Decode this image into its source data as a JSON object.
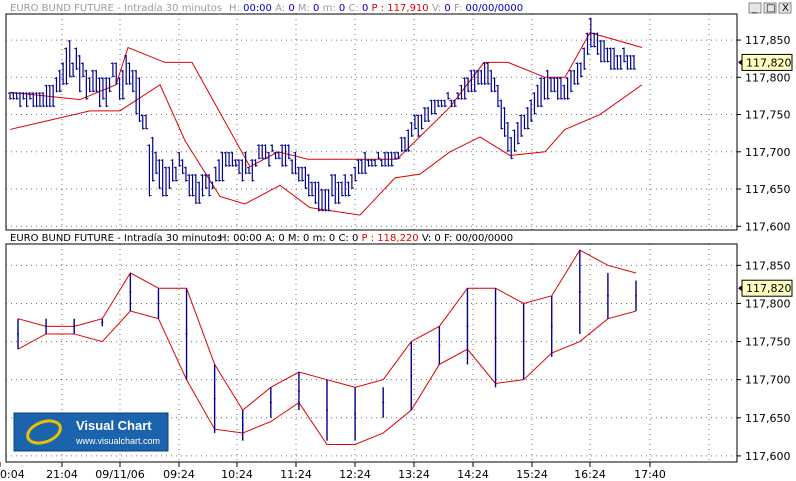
{
  "panels": [
    {
      "title": "EURO BUND FUTURE - Intradía 30 minutos",
      "header_fields": [
        {
          "k": "H:",
          "v": "00:00"
        },
        {
          "k": "A:",
          "v": "0"
        },
        {
          "k": "M:",
          "v": "0"
        },
        {
          "k": "m:",
          "v": "0"
        },
        {
          "k": "C:",
          "v": "0"
        },
        {
          "k": "P :",
          "v": "117,910",
          "accent": true
        },
        {
          "k": "V:",
          "v": "0"
        },
        {
          "k": "F:",
          "v": "00/00/0000"
        }
      ],
      "price_tag": "117,820",
      "controls": [
        "_",
        "□",
        "X"
      ]
    },
    {
      "title": "EURO BUND FUTURE - Intradía 30 minutos",
      "header_fields": [
        {
          "k": "H:",
          "v": "00:00"
        },
        {
          "k": "A:",
          "v": "0"
        },
        {
          "k": "M:",
          "v": "0"
        },
        {
          "k": "m:",
          "v": "0"
        },
        {
          "k": "C:",
          "v": "0"
        },
        {
          "k": "P :",
          "v": "118,220",
          "accent": true
        },
        {
          "k": "V:",
          "v": "0"
        },
        {
          "k": "F:",
          "v": "00/00/0000"
        }
      ],
      "price_tag": "117,820"
    }
  ],
  "x_axis_labels": [
    "0:04",
    "21:04",
    "09/11/06",
    "09:24",
    "10:24",
    "11:24",
    "12:24",
    "13:24",
    "14:24",
    "15:24",
    "16:24",
    "17:40"
  ],
  "logo": {
    "title": "Visual Chart",
    "url": "www.visualchart.com"
  },
  "colors": {
    "bars": "#00008b",
    "bands": "#e00000",
    "price_tag_bg": "#ffffc0"
  },
  "chart_data": [
    {
      "type": "ohlc",
      "y_ticks": [
        "117,600",
        "117,650",
        "117,700",
        "117,750",
        "117,800",
        "117,850"
      ],
      "ylim": [
        117.595,
        117.885
      ],
      "grid": true,
      "bars_hl": [
        [
          117.77,
          117.78
        ],
        [
          117.77,
          117.78
        ],
        [
          117.77,
          117.78
        ],
        [
          117.76,
          117.78
        ],
        [
          117.77,
          117.78
        ],
        [
          117.76,
          117.78
        ],
        [
          117.77,
          117.78
        ],
        [
          117.76,
          117.78
        ],
        [
          117.76,
          117.78
        ],
        [
          117.76,
          117.78
        ],
        [
          117.76,
          117.78
        ],
        [
          117.76,
          117.79
        ],
        [
          117.76,
          117.79
        ],
        [
          117.76,
          117.79
        ],
        [
          117.78,
          117.8
        ],
        [
          117.78,
          117.81
        ],
        [
          117.79,
          117.82
        ],
        [
          117.79,
          117.84
        ],
        [
          117.8,
          117.85
        ],
        [
          117.8,
          117.82
        ],
        [
          117.81,
          117.84
        ],
        [
          117.78,
          117.83
        ],
        [
          117.8,
          117.82
        ],
        [
          117.77,
          117.81
        ],
        [
          117.78,
          117.8
        ],
        [
          117.78,
          117.81
        ],
        [
          117.78,
          117.81
        ],
        [
          117.76,
          117.8
        ],
        [
          117.77,
          117.8
        ],
        [
          117.76,
          117.8
        ],
        [
          117.78,
          117.8
        ],
        [
          117.8,
          117.82
        ],
        [
          117.79,
          117.82
        ],
        [
          117.77,
          117.8
        ],
        [
          117.77,
          117.81
        ],
        [
          117.79,
          117.83
        ],
        [
          117.79,
          117.82
        ],
        [
          117.78,
          117.81
        ],
        [
          117.75,
          117.81
        ],
        [
          117.74,
          117.8
        ],
        [
          117.73,
          117.75
        ],
        [
          117.73,
          117.75
        ],
        [
          117.64,
          117.71
        ],
        [
          117.66,
          117.72
        ],
        [
          117.67,
          117.7
        ],
        [
          117.65,
          117.69
        ],
        [
          117.64,
          117.69
        ],
        [
          117.64,
          117.68
        ],
        [
          117.65,
          117.68
        ],
        [
          117.66,
          117.69
        ],
        [
          117.66,
          117.68
        ],
        [
          117.68,
          117.7
        ],
        [
          117.67,
          117.69
        ],
        [
          117.66,
          117.68
        ],
        [
          117.64,
          117.67
        ],
        [
          117.64,
          117.67
        ],
        [
          117.63,
          117.67
        ],
        [
          117.63,
          117.66
        ],
        [
          117.64,
          117.67
        ],
        [
          117.65,
          117.67
        ],
        [
          117.64,
          117.67
        ],
        [
          117.65,
          117.66
        ],
        [
          117.66,
          117.68
        ],
        [
          117.66,
          117.69
        ],
        [
          117.66,
          117.7
        ],
        [
          117.68,
          117.7
        ],
        [
          117.68,
          117.7
        ],
        [
          117.68,
          117.7
        ],
        [
          117.68,
          117.69
        ],
        [
          117.67,
          117.69
        ],
        [
          117.66,
          117.69
        ],
        [
          117.67,
          117.7
        ],
        [
          117.67,
          117.68
        ],
        [
          117.66,
          117.69
        ],
        [
          117.68,
          117.69
        ],
        [
          117.69,
          117.71
        ],
        [
          117.69,
          117.71
        ],
        [
          117.69,
          117.71
        ],
        [
          117.68,
          117.7
        ],
        [
          117.7,
          117.71
        ],
        [
          117.69,
          117.7
        ],
        [
          117.69,
          117.7
        ],
        [
          117.68,
          117.71
        ],
        [
          117.68,
          117.71
        ],
        [
          117.69,
          117.71
        ],
        [
          117.67,
          117.69
        ],
        [
          117.67,
          117.7
        ],
        [
          117.66,
          117.68
        ],
        [
          117.66,
          117.68
        ],
        [
          117.65,
          117.68
        ],
        [
          117.64,
          117.67
        ],
        [
          117.64,
          117.66
        ],
        [
          117.63,
          117.66
        ],
        [
          117.62,
          117.66
        ],
        [
          117.62,
          117.65
        ],
        [
          117.62,
          117.65
        ],
        [
          117.62,
          117.65
        ],
        [
          117.64,
          117.67
        ],
        [
          117.63,
          117.67
        ],
        [
          117.63,
          117.66
        ],
        [
          117.64,
          117.66
        ],
        [
          117.64,
          117.67
        ],
        [
          117.64,
          117.66
        ],
        [
          117.65,
          117.67
        ],
        [
          117.66,
          117.68
        ],
        [
          117.67,
          117.69
        ],
        [
          117.67,
          117.69
        ],
        [
          117.67,
          117.7
        ],
        [
          117.68,
          117.69
        ],
        [
          117.68,
          117.69
        ],
        [
          117.68,
          117.69
        ],
        [
          117.69,
          117.7
        ],
        [
          117.68,
          117.69
        ],
        [
          117.68,
          117.7
        ],
        [
          117.68,
          117.7
        ],
        [
          117.68,
          117.7
        ],
        [
          117.69,
          117.7
        ],
        [
          117.69,
          117.7
        ],
        [
          117.7,
          117.72
        ],
        [
          117.7,
          117.72
        ],
        [
          117.7,
          117.73
        ],
        [
          117.72,
          117.74
        ],
        [
          117.73,
          117.75
        ],
        [
          117.72,
          117.75
        ],
        [
          117.73,
          117.75
        ],
        [
          117.74,
          117.76
        ],
        [
          117.74,
          117.76
        ],
        [
          117.75,
          117.77
        ],
        [
          117.75,
          117.77
        ],
        [
          117.76,
          117.77
        ],
        [
          117.76,
          117.77
        ],
        [
          117.76,
          117.77
        ],
        [
          117.77,
          117.78
        ],
        [
          117.76,
          117.77
        ],
        [
          117.76,
          117.77
        ],
        [
          117.77,
          117.78
        ],
        [
          117.77,
          117.79
        ],
        [
          117.77,
          117.8
        ],
        [
          117.78,
          117.8
        ],
        [
          117.78,
          117.81
        ],
        [
          117.78,
          117.81
        ],
        [
          117.79,
          117.81
        ],
        [
          117.79,
          117.81
        ],
        [
          117.79,
          117.82
        ],
        [
          117.79,
          117.82
        ],
        [
          117.78,
          117.81
        ],
        [
          117.78,
          117.8
        ],
        [
          117.76,
          117.79
        ],
        [
          117.73,
          117.77
        ],
        [
          117.72,
          117.76
        ],
        [
          117.7,
          117.74
        ],
        [
          117.69,
          117.72
        ],
        [
          117.7,
          117.73
        ],
        [
          117.71,
          117.74
        ],
        [
          117.72,
          117.75
        ],
        [
          117.73,
          117.75
        ],
        [
          117.73,
          117.76
        ],
        [
          117.74,
          117.77
        ],
        [
          117.75,
          117.78
        ],
        [
          117.76,
          117.79
        ],
        [
          117.76,
          117.8
        ],
        [
          117.77,
          117.8
        ],
        [
          117.77,
          117.81
        ],
        [
          117.78,
          117.8
        ],
        [
          117.78,
          117.8
        ],
        [
          117.77,
          117.8
        ],
        [
          117.77,
          117.8
        ],
        [
          117.77,
          117.79
        ],
        [
          117.77,
          117.8
        ],
        [
          117.78,
          117.81
        ],
        [
          117.79,
          117.81
        ],
        [
          117.79,
          117.82
        ],
        [
          117.8,
          117.82
        ],
        [
          117.81,
          117.84
        ],
        [
          117.83,
          117.86
        ],
        [
          117.84,
          117.88
        ],
        [
          117.84,
          117.86
        ],
        [
          117.83,
          117.86
        ],
        [
          117.82,
          117.85
        ],
        [
          117.82,
          117.85
        ],
        [
          117.82,
          117.84
        ],
        [
          117.81,
          117.84
        ],
        [
          117.81,
          117.84
        ],
        [
          117.81,
          117.83
        ],
        [
          117.81,
          117.83
        ],
        [
          117.82,
          117.84
        ],
        [
          117.81,
          117.83
        ],
        [
          117.81,
          117.83
        ],
        [
          117.81,
          117.83
        ]
      ],
      "band_upper_x": [
        0,
        70,
        106,
        118,
        155,
        182,
        240,
        268,
        298,
        350,
        387,
        440,
        474,
        498,
        535,
        555,
        580,
        632
      ],
      "band_upper": [
        117.78,
        117.77,
        117.79,
        117.84,
        117.82,
        117.82,
        117.68,
        117.7,
        117.69,
        117.69,
        117.69,
        117.76,
        117.82,
        117.82,
        117.8,
        117.8,
        117.86,
        117.84
      ],
      "band_lower_x": [
        0,
        80,
        110,
        150,
        175,
        210,
        235,
        270,
        300,
        350,
        385,
        410,
        440,
        470,
        500,
        535,
        555,
        590,
        632
      ],
      "band_lower": [
        117.73,
        117.755,
        117.755,
        117.79,
        117.715,
        117.64,
        117.63,
        117.655,
        117.625,
        117.615,
        117.665,
        117.67,
        117.7,
        117.72,
        117.695,
        117.7,
        117.73,
        117.75,
        117.79
      ]
    },
    {
      "type": "ohlc",
      "y_ticks": [
        "117,600",
        "117,650",
        "117,700",
        "117,750",
        "117,800",
        "117,850"
      ],
      "ylim": [
        117.592,
        117.878
      ],
      "grid": true,
      "bars_hl": [
        [
          117.74,
          117.78
        ],
        [
          117.76,
          117.78
        ],
        [
          117.76,
          117.78
        ],
        [
          117.77,
          117.78
        ],
        [
          117.79,
          117.84
        ],
        [
          117.78,
          117.82
        ],
        [
          117.7,
          117.82
        ],
        [
          117.63,
          117.72
        ],
        [
          117.62,
          117.66
        ],
        [
          117.65,
          117.69
        ],
        [
          117.66,
          117.71
        ],
        [
          117.62,
          117.7
        ],
        [
          117.62,
          117.69
        ],
        [
          117.65,
          117.69
        ],
        [
          117.66,
          117.75
        ],
        [
          117.72,
          117.77
        ],
        [
          117.72,
          117.82
        ],
        [
          117.69,
          117.82
        ],
        [
          117.7,
          117.8
        ],
        [
          117.73,
          117.81
        ],
        [
          117.76,
          117.87
        ],
        [
          117.78,
          117.84
        ],
        [
          117.79,
          117.83
        ]
      ],
      "band_upper": [
        117.78,
        117.77,
        117.77,
        117.78,
        117.84,
        117.82,
        117.82,
        117.72,
        117.66,
        117.69,
        117.71,
        117.7,
        117.69,
        117.7,
        117.75,
        117.77,
        117.82,
        117.82,
        117.8,
        117.81,
        117.87,
        117.85,
        117.84
      ],
      "band_lower": [
        117.74,
        117.76,
        117.76,
        117.75,
        117.79,
        117.78,
        117.7,
        117.635,
        117.63,
        117.645,
        117.67,
        117.615,
        117.615,
        117.63,
        117.66,
        117.72,
        117.74,
        117.695,
        117.7,
        117.735,
        117.75,
        117.78,
        117.79
      ]
    }
  ]
}
